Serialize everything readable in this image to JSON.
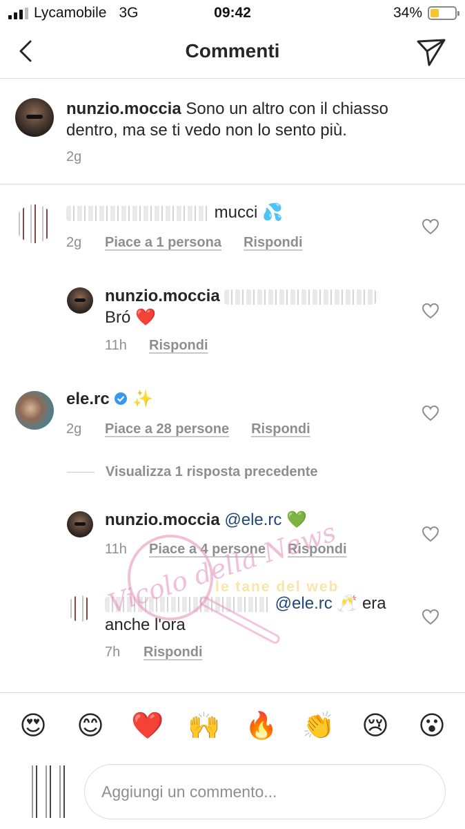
{
  "status_bar": {
    "carrier": "Lycamobile",
    "network": "3G",
    "time": "09:42",
    "battery_percent": "34%",
    "battery_level": 0.34
  },
  "header": {
    "title": "Commenti",
    "back_icon": "chevron-left-icon",
    "share_icon": "paper-plane-icon"
  },
  "caption": {
    "username": "nunzio.moccia",
    "text": "Sono un altro con il chiasso dentro, ma se ti vedo non lo sento più.",
    "line1": "Sono un altro con il chiasso",
    "line2": "dentro, ma se ti vedo non lo sento più.",
    "timestamp": "2g"
  },
  "comments": [
    {
      "username_hidden": true,
      "text_suffix": "mucci 💦",
      "timestamp": "2g",
      "likes_label": "Piace a 1 persona",
      "reply_label": "Rispondi",
      "reply": {
        "username": "nunzio.moccia",
        "text": "Bró ❤️",
        "timestamp": "11h",
        "reply_label": "Rispondi"
      }
    },
    {
      "username": "ele.rc",
      "verified": true,
      "text": "✨",
      "timestamp": "2g",
      "likes_label": "Piace a 28 persone",
      "reply_label": "Rispondi",
      "view_previous": "Visualizza 1 risposta precedente",
      "replies": [
        {
          "username": "nunzio.moccia",
          "mention": "@ele.rc",
          "text": "💚",
          "timestamp": "11h",
          "likes_label": "Piace a 4 persone",
          "reply_label": "Rispondi"
        },
        {
          "username_hidden": true,
          "mention": "@ele.rc",
          "text_line1": "🥂 era",
          "text_line2": "anche l'ora",
          "timestamp": "7h",
          "reply_label": "Rispondi"
        }
      ]
    }
  ],
  "watermark": {
    "text1": "Vicolo della News",
    "text2": "le tane del web"
  },
  "emoji_bar": [
    "😍",
    "😊",
    "❤️",
    "🙌",
    "🔥",
    "👏",
    "😢",
    "😮"
  ],
  "composer": {
    "placeholder": "Aggiungi un commento..."
  }
}
